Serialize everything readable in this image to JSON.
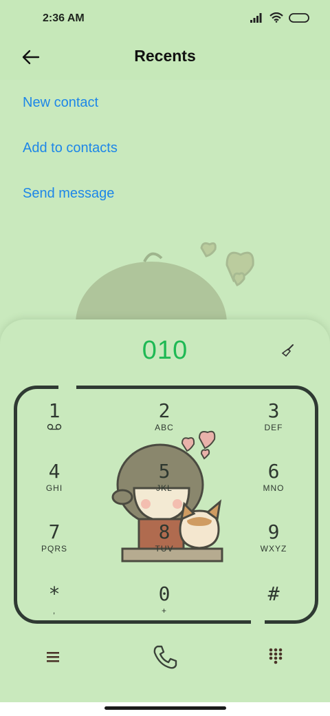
{
  "status": {
    "time": "2:36 AM"
  },
  "header": {
    "title": "Recents"
  },
  "actions": [
    {
      "label": "New contact"
    },
    {
      "label": "Add to contacts"
    },
    {
      "label": "Send message"
    }
  ],
  "dialer": {
    "number": "010",
    "keys": [
      {
        "num": "1",
        "sub": "voicemail-icon"
      },
      {
        "num": "2",
        "sub": "ABC"
      },
      {
        "num": "3",
        "sub": "DEF"
      },
      {
        "num": "4",
        "sub": "GHI"
      },
      {
        "num": "5",
        "sub": "JKL"
      },
      {
        "num": "6",
        "sub": "MNO"
      },
      {
        "num": "7",
        "sub": "PQRS"
      },
      {
        "num": "8",
        "sub": "TUV"
      },
      {
        "num": "9",
        "sub": "WXYZ"
      },
      {
        "num": "*",
        "sub": ","
      },
      {
        "num": "0",
        "sub": "+"
      },
      {
        "num": "#",
        "sub": ""
      }
    ]
  },
  "colors": {
    "accent_link": "#1d86e8",
    "digits": "#1fb954",
    "background": "#c9e9bd"
  }
}
